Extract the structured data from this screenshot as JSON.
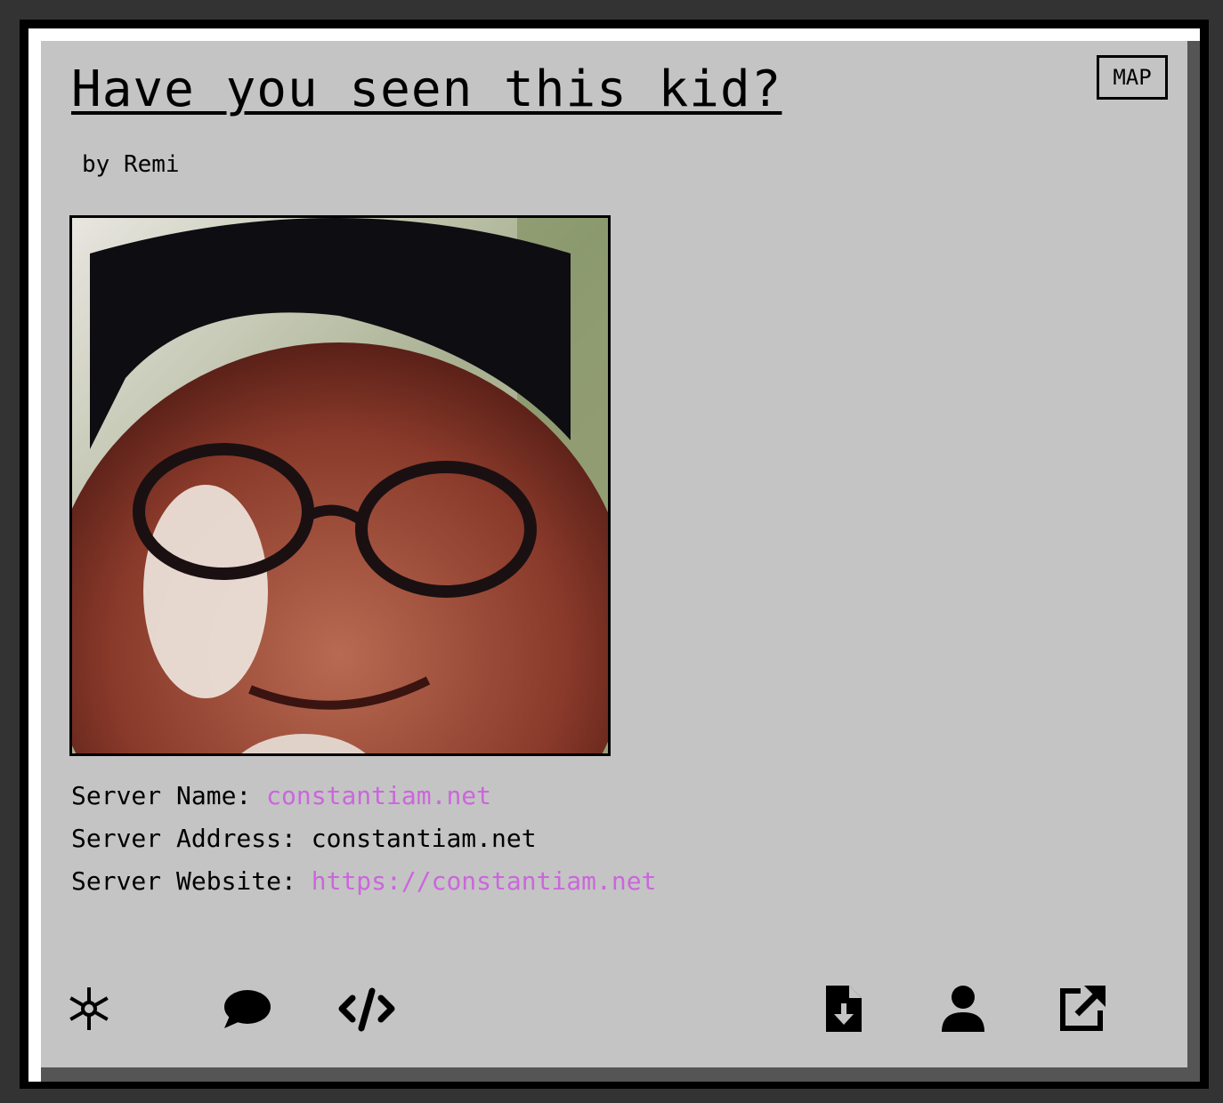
{
  "post": {
    "title": "Have you seen this kid?",
    "byline": "by Remi",
    "map_label": "MAP"
  },
  "server": {
    "name_label": "Server Name:",
    "name_value": "constantiam.net",
    "address_label": "Server Address:",
    "address_value": "constantiam.net",
    "website_label": "Server Website:",
    "website_value": "https://constantiam.net"
  },
  "toolbar": {
    "left_icons": [
      "asterisk-icon",
      "comment-icon",
      "code-icon"
    ],
    "right_icons": [
      "file-download-icon",
      "user-icon",
      "external-link-icon"
    ]
  },
  "colors": {
    "page_bg": "#333333",
    "panel_bg": "#c4c4c4",
    "link": "#cc66dd"
  }
}
